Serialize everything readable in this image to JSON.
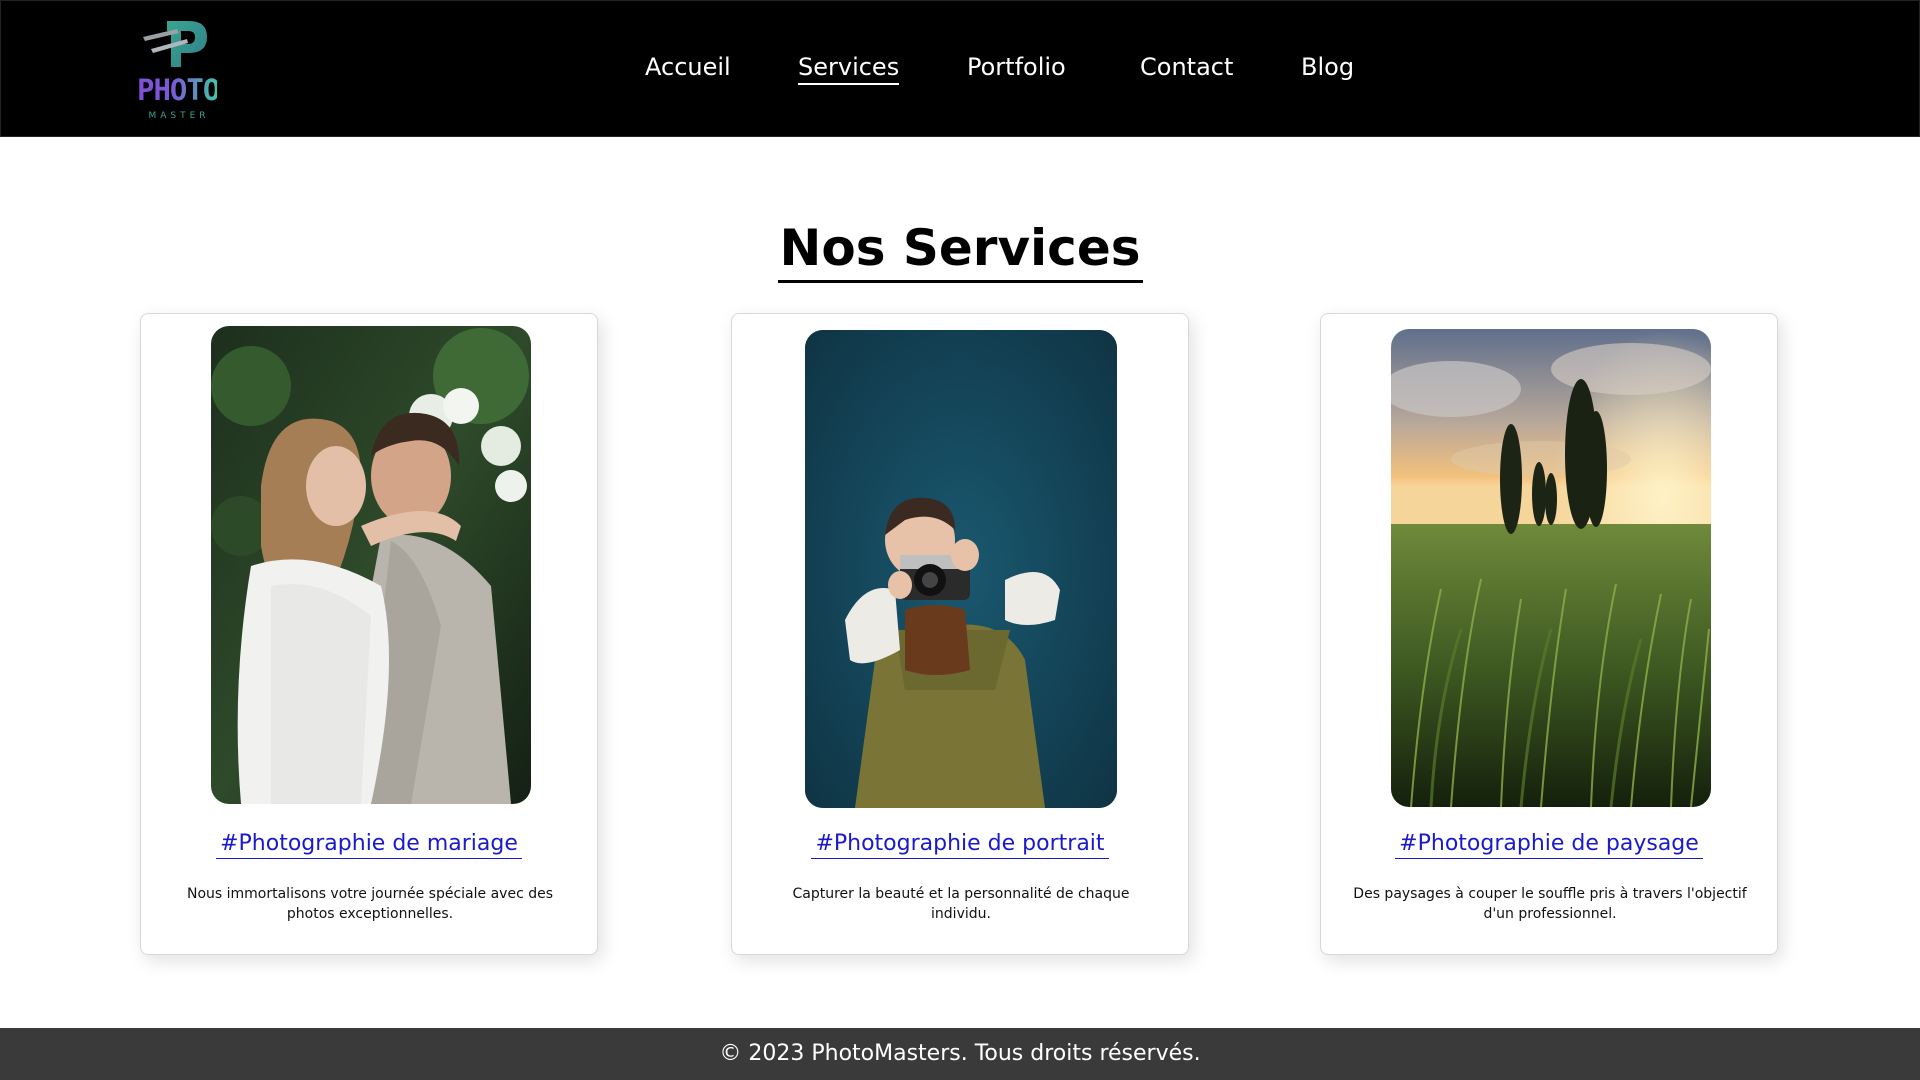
{
  "brand": {
    "logo_word": "PHOTO",
    "logo_sub": "MASTER"
  },
  "nav": {
    "items": [
      {
        "label": "Accueil"
      },
      {
        "label": "Services"
      },
      {
        "label": "Portfolio"
      },
      {
        "label": "Contact"
      },
      {
        "label": "Blog"
      }
    ],
    "active": "Services"
  },
  "main": {
    "title": "Nos Services",
    "cards": [
      {
        "title": "#Photographie de mariage",
        "description": "Nous immortalisons votre journée spéciale avec des photos exceptionnelles.",
        "image": "wedding-couple-photo"
      },
      {
        "title": "#Photographie de portrait",
        "description": "Capturer la beauté et la personnalité de chaque individu.",
        "image": "girl-with-camera-portrait-photo"
      },
      {
        "title": "#Photographie de paysage",
        "description": "Des paysages à couper le souffle pris à travers l'objectif d'un professionnel.",
        "image": "wheat-field-sunset-landscape-photo"
      }
    ]
  },
  "footer": {
    "text": "© 2023 PhotoMasters. Tous droits réservés."
  },
  "colors": {
    "header_bg": "#000000",
    "footer_bg": "#3a3a3a",
    "link": "#1a1acc"
  }
}
